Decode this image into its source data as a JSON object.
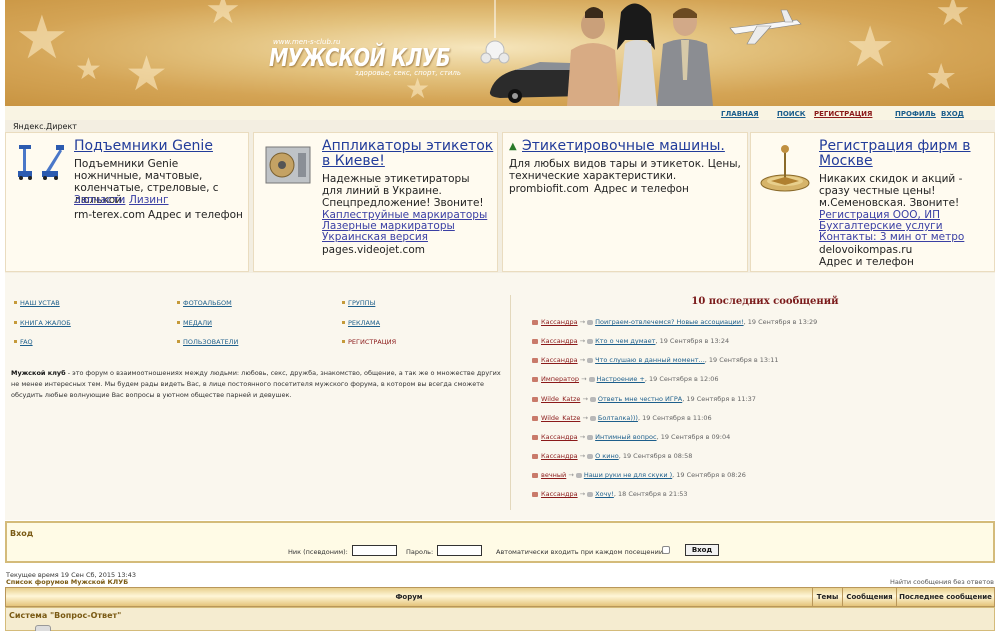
{
  "header": {
    "site_url": "www.men-s-club.ru",
    "site_title": "МУЖСКОЙ КЛУБ",
    "tagline": "здоровье, секс, спорт, стиль"
  },
  "nav": {
    "index": "ГЛАВНАЯ",
    "search": "ПОИСК",
    "register": "РЕГИСТРАЦИЯ",
    "profile": "ПРОФИЛЬ",
    "login": "ВХОД"
  },
  "ads": {
    "label": "Яндекс.Директ",
    "items": [
      {
        "title": "Подъемники Genie",
        "text": "Подъемники Genie ножничные, мачтовые, коленчатые, стреловые, с люлькой.",
        "links": [
          "Запчасти",
          "Лизинг"
        ],
        "domain": "rm-terex.com",
        "address": "Адрес и телефон"
      },
      {
        "title": "Аппликаторы этикеток в Киеве!",
        "text": "Надежные этикетираторы для линий в Украине. Спецпредложение! Звоните!",
        "links": [
          "Каплеструйные маркираторы",
          "Лазерные маркираторы",
          "Украинская версия"
        ],
        "domain": "pages.videojet.com"
      },
      {
        "title": "Этикетировочные машины.",
        "text": "Для любых видов тары и этикеток. Цены, технические характеристики.",
        "domain": "prombiofit.com",
        "address": "Адрес и телефон"
      },
      {
        "title": "Регистрация фирм в Москве",
        "text": "Никаких скидок и акций - сразу честные цены! м.Семеновская. Звоните!",
        "links": [
          "Регистрация ООО, ИП",
          "Бухгалтерские услуги",
          "Контакты: 3 мин от метро"
        ],
        "domain": "delovoikompas.ru",
        "address": "Адрес и телефон"
      }
    ]
  },
  "menu": {
    "col1": [
      "НАШ УСТАВ",
      "КНИГА ЖАЛОБ",
      "FAQ"
    ],
    "col2": [
      "ФОТОАЛЬБОМ",
      "МЕДАЛИ",
      "ПОЛЬЗОВАТЕЛИ"
    ],
    "col3": [
      "ГРУППЫ",
      "РЕКЛАМА",
      "РЕГИСТРАЦИЯ"
    ]
  },
  "about": {
    "site_name": "Мужской клуб",
    "text": " - это форум о взаимоотношениях между людьми: любовь, секс, дружба, знакомство, общение, а так же о множестве других не менее интересных тем. Мы будем рады видеть Вас, в лице постоянного посетителя мужского форума, в котором вы всегда сможете обсудить любые волнующие Вас вопросы в уютном обществе парней и девушек."
  },
  "recent": {
    "title": "10 последних сообщений",
    "messages": [
      {
        "user": "Кассандра",
        "topic": "Поиграем-отвлечемся? Новые ассоциации!",
        "date": ", 19 Сентября в 13:29"
      },
      {
        "user": "Кассандра",
        "topic": "Кто о чем думает",
        "date": ", 19 Сентября в 13:24"
      },
      {
        "user": "Кассандра",
        "topic": "Что слушаю в данный момент...",
        "date": ", 19 Сентября в 13:11"
      },
      {
        "user": "Император",
        "topic": "Настроение +",
        "date": ", 19 Сентября в 12:06"
      },
      {
        "user": "Wilde_Katze",
        "topic": "Ответь мне честно ИГРА",
        "date": ", 19 Сентября в 11:37"
      },
      {
        "user": "Wilde_Katze",
        "topic": "Болталка)))",
        "date": ", 19 Сентября в 11:06"
      },
      {
        "user": "Кассандра",
        "topic": "Интимный вопрос",
        "date": ", 19 Сентября в 09:04"
      },
      {
        "user": "Кассандра",
        "topic": "О кино",
        "date": ", 19 Сентября в 08:58"
      },
      {
        "user": "вечный",
        "topic": "Наши руки не для скуки )",
        "date": ", 19 Сентября в 08:26"
      },
      {
        "user": "Кассандра",
        "topic": "Хочу!",
        "date": ", 18 Сентября в 21:53"
      }
    ]
  },
  "login": {
    "title": "Вход",
    "nick_label": "Ник (псевдоним):",
    "nick_value": "",
    "pass_label": "Пароль:",
    "pass_value": "",
    "auto_label": "Автоматически входить при каждом посещении",
    "button": "Вход"
  },
  "status": {
    "current_time": "Текущее время 19 Сен Сб, 2015 13:43",
    "forum_list": "Список форумов Мужской КЛУБ",
    "unanswered": "Найти сообщения без ответов"
  },
  "forum_table": {
    "headers": [
      "Форум",
      "Темы",
      "Сообщения",
      "Последнее сообщение"
    ],
    "category": "Система \"Вопрос-Ответ\""
  },
  "colors": {
    "header_gold": "#d4a455",
    "link_blue": "#1d5f8c",
    "ad_blue": "#223c9a",
    "dark_red": "#8b1a1a",
    "brown": "#7a5a14"
  }
}
